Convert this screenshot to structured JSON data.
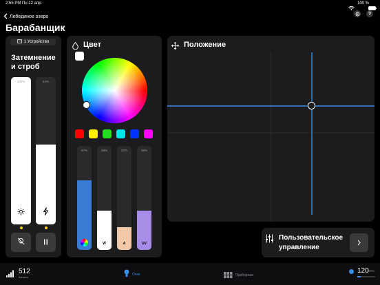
{
  "status_bar": {
    "time": "2:55 PM",
    "date": "Пн 12 апр.",
    "battery": "100 %"
  },
  "nav": {
    "back_label": "Лебединое озеро"
  },
  "page": {
    "title": "Барабанщик"
  },
  "device": {
    "label": "1 Устройство"
  },
  "dimmer": {
    "title_line1": "Затемнение",
    "title_line2": "и строб",
    "dimmer_value": "100%",
    "dimmer_level": 1.0,
    "strobe_value": "54%",
    "strobe_level": 0.54
  },
  "color": {
    "title": "Цвет",
    "swatches": [
      "#ff0000",
      "#ffee00",
      "#22dd22",
      "#00e5e5",
      "#0033ff",
      "#ff00ff"
    ],
    "sliders": [
      {
        "value": "67%",
        "level": 0.67,
        "label": "",
        "color": "#3a7bd5"
      },
      {
        "value": "38%",
        "level": 0.38,
        "label": "W",
        "color": "#ffffff"
      },
      {
        "value": "22%",
        "level": 0.22,
        "label": "A",
        "color": "#f2c8a8"
      },
      {
        "value": "38%",
        "level": 0.38,
        "label": "UV",
        "color": "#a98be8"
      }
    ]
  },
  "position": {
    "title": "Положение"
  },
  "custom": {
    "label_line1": "Пользовательское",
    "label_line2": "управление"
  },
  "bottom": {
    "channels": "512",
    "channels_label": "Каналы",
    "tab_active": "Огни",
    "tab_console": "Приборная",
    "bpm": "120",
    "bpm_unit": "BPM"
  }
}
